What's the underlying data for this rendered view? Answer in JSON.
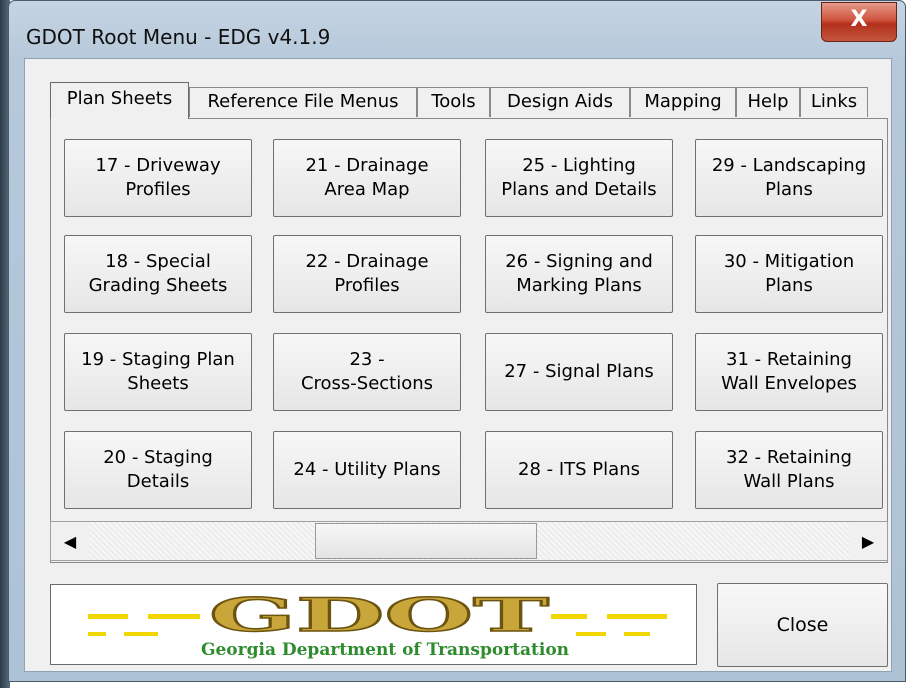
{
  "window": {
    "title": "GDOT Root Menu - EDG v4.1.9",
    "close_glyph": "X"
  },
  "tabs": [
    {
      "label": "Plan Sheets"
    },
    {
      "label": "Reference File Menus"
    },
    {
      "label": "Tools"
    },
    {
      "label": "Design Aids"
    },
    {
      "label": "Mapping"
    },
    {
      "label": "Help"
    },
    {
      "label": "Links"
    }
  ],
  "active_tab": "Plan Sheets",
  "sheet_buttons": [
    {
      "label": "17 - Driveway\nProfiles"
    },
    {
      "label": "21 - Drainage\nArea Map"
    },
    {
      "label": "25 - Lighting\nPlans and Details"
    },
    {
      "label": "29 - Landscaping\nPlans"
    },
    {
      "label": "18 - Special\nGrading Sheets"
    },
    {
      "label": "22 - Drainage\nProfiles"
    },
    {
      "label": "26 - Signing and\nMarking Plans"
    },
    {
      "label": "30 - Mitigation\nPlans"
    },
    {
      "label": "19 - Staging Plan\nSheets"
    },
    {
      "label": "23 -\nCross-Sections"
    },
    {
      "label": "27 - Signal Plans"
    },
    {
      "label": "31 - Retaining\nWall Envelopes"
    },
    {
      "label": "20 - Staging\nDetails"
    },
    {
      "label": "24 - Utility Plans"
    },
    {
      "label": "28 - ITS Plans"
    },
    {
      "label": "32 - Retaining\nWall Plans"
    }
  ],
  "scrollbar": {
    "left_arrow": "◀",
    "right_arrow": "▶"
  },
  "logo": {
    "wordmark": "GDOT",
    "caption": "Georgia Department of Transportation"
  },
  "close_button": {
    "label": "Close"
  },
  "colors": {
    "logo_gold": "#c9a63a",
    "logo_yellow": "#f2d600",
    "logo_green": "#2e8b2e"
  }
}
